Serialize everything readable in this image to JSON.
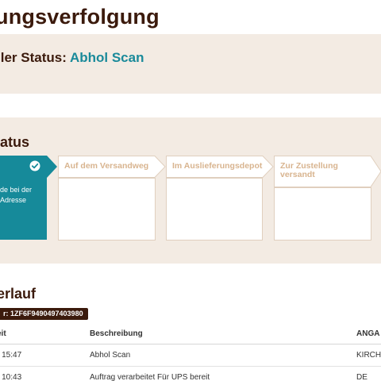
{
  "page": {
    "title": "ungsverfolgung"
  },
  "current_status": {
    "prefix": "ller Status:",
    "value": "Abhol Scan"
  },
  "progress": {
    "heading": "tatus",
    "steps": [
      {
        "label": "de bei der Adresse",
        "state": "done"
      },
      {
        "label": "Auf dem Versandweg",
        "state": "pending"
      },
      {
        "label": "Im Auslieferungsdepot",
        "state": "pending"
      },
      {
        "label": "Zur Zustellung versandt",
        "state": "pending"
      }
    ]
  },
  "history": {
    "heading": "erlauf",
    "tracking": "r: 1ZF6F9490497403980",
    "columns": [
      "eit",
      "Beschreibung",
      "ANGA"
    ],
    "rows": [
      {
        "time": "- 15:47",
        "description": "Abhol Scan",
        "info": "KIRCH"
      },
      {
        "time": "- 10:43",
        "description": "Auftrag verarbeitet Für UPS bereit",
        "info": "DE"
      }
    ]
  },
  "colors": {
    "accent": "#168a9a",
    "brown": "#3b1a0c",
    "panel_bg": "#f3ebe3",
    "step_label": "#d8b48f"
  }
}
